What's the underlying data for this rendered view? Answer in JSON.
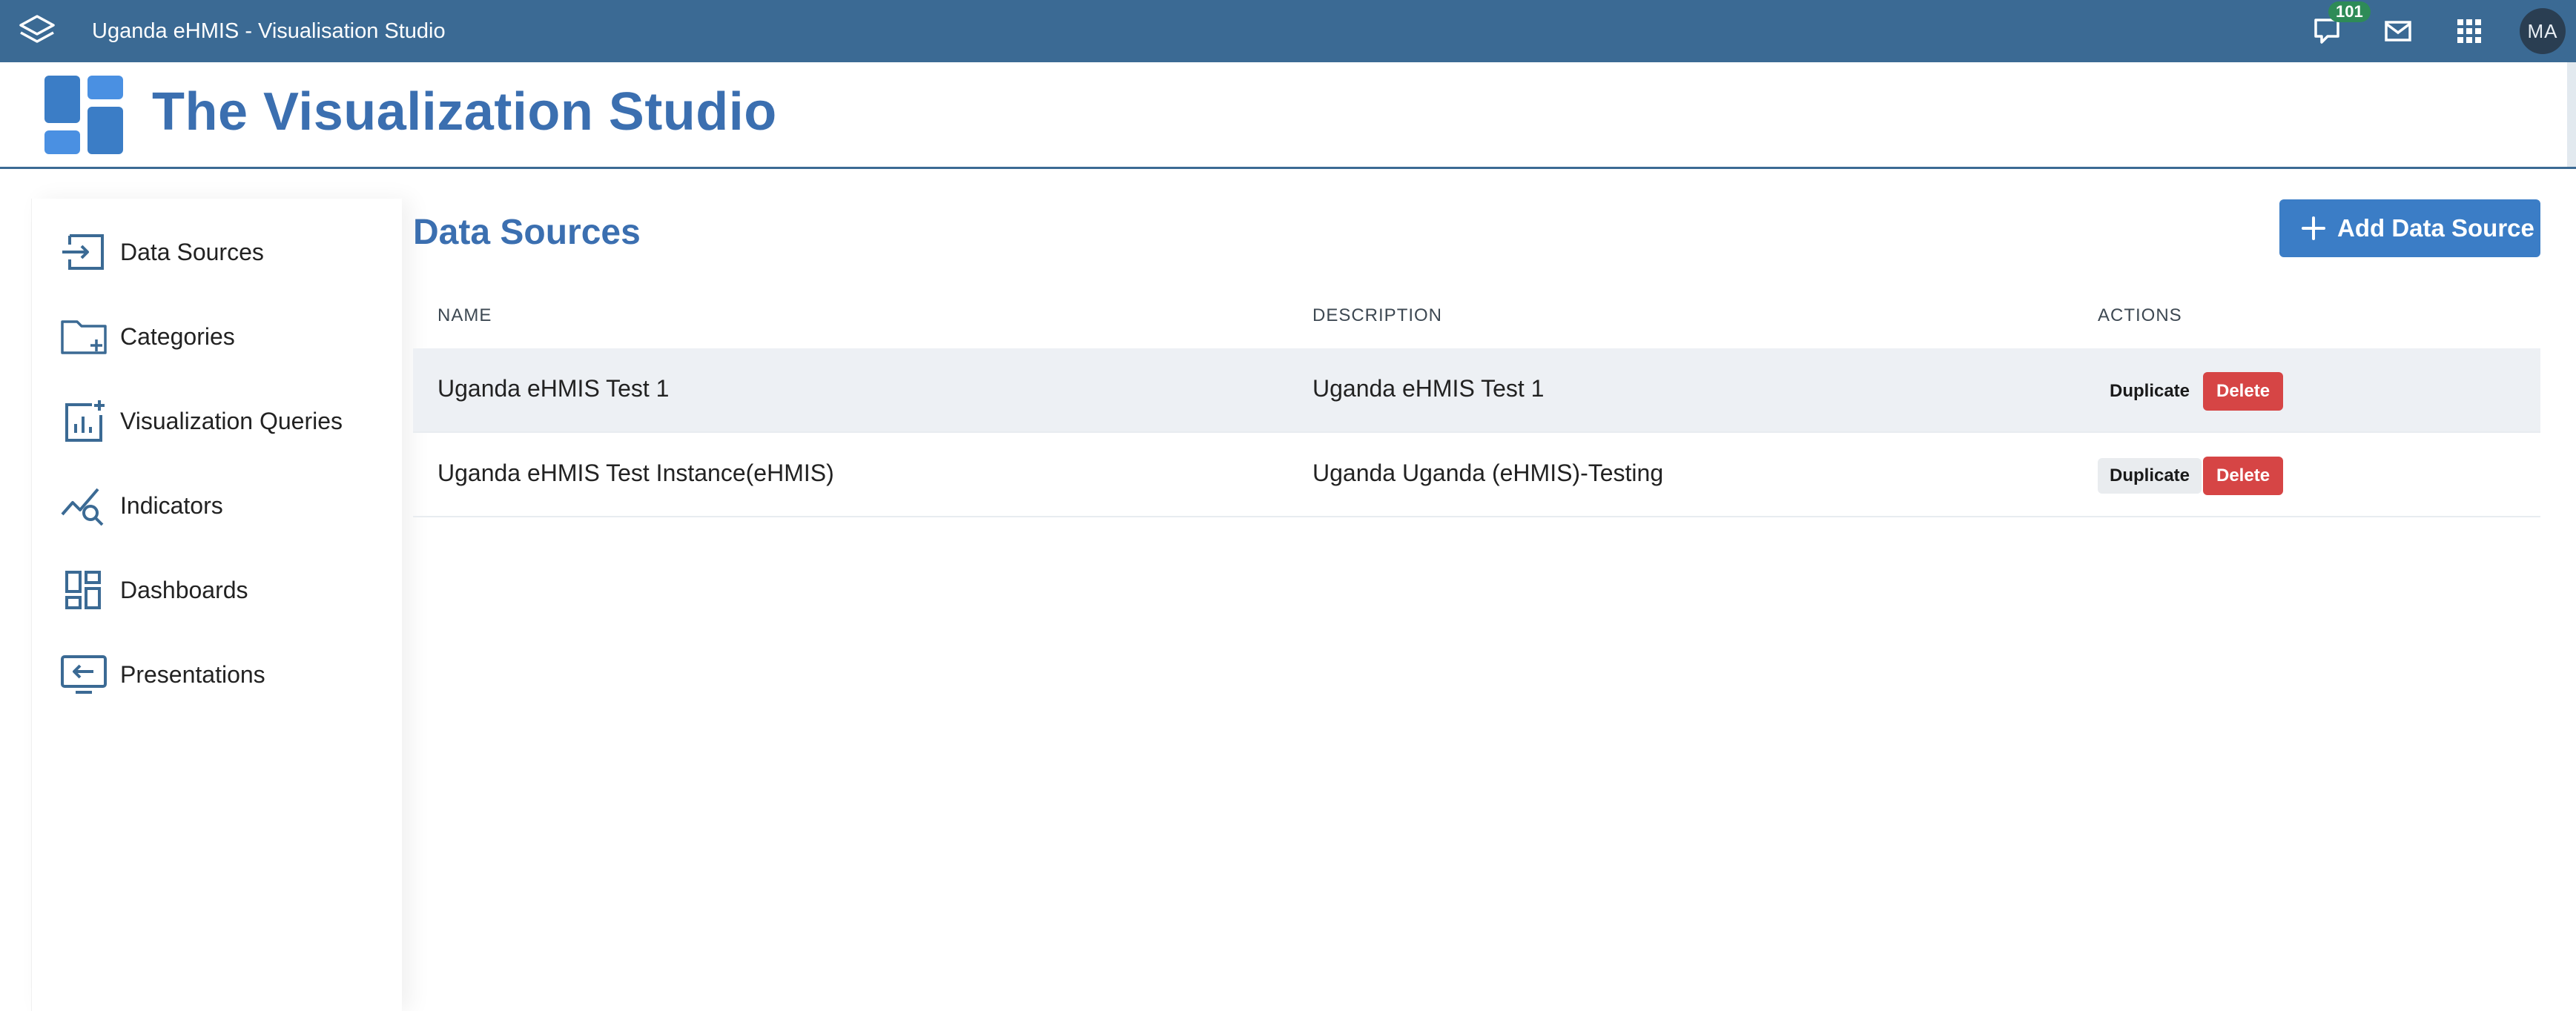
{
  "topbar": {
    "app_title": "Uganda eHMIS - Visualisation Studio",
    "notification_count": "101",
    "avatar_initials": "MA"
  },
  "studio": {
    "title": "The Visualization Studio"
  },
  "sidebar": {
    "items": [
      {
        "label": "Data Sources",
        "icon": "data-source-icon"
      },
      {
        "label": "Categories",
        "icon": "folder-add-icon"
      },
      {
        "label": "Visualization Queries",
        "icon": "chart-add-icon"
      },
      {
        "label": "Indicators",
        "icon": "indicator-search-icon"
      },
      {
        "label": "Dashboards",
        "icon": "dashboard-icon"
      },
      {
        "label": "Presentations",
        "icon": "presentation-icon"
      }
    ]
  },
  "main": {
    "title": "Data Sources",
    "add_button_label": "Add Data Source",
    "columns": [
      "NAME",
      "DESCRIPTION",
      "ACTIONS"
    ],
    "rows": [
      {
        "name": "Uganda eHMIS Test 1",
        "description": "Uganda eHMIS Test 1",
        "duplicate_label": "Duplicate",
        "delete_label": "Delete"
      },
      {
        "name": "Uganda eHMIS Test Instance(eHMIS)",
        "description": "Uganda Uganda (eHMIS)-Testing",
        "duplicate_label": "Duplicate",
        "delete_label": "Delete"
      }
    ]
  },
  "colors": {
    "header_bg": "#3b6a94",
    "brand_blue": "#3b6fb0",
    "button_blue": "#3b7dc6",
    "delete_red": "#d64545",
    "badge_green": "#2e8b57"
  }
}
